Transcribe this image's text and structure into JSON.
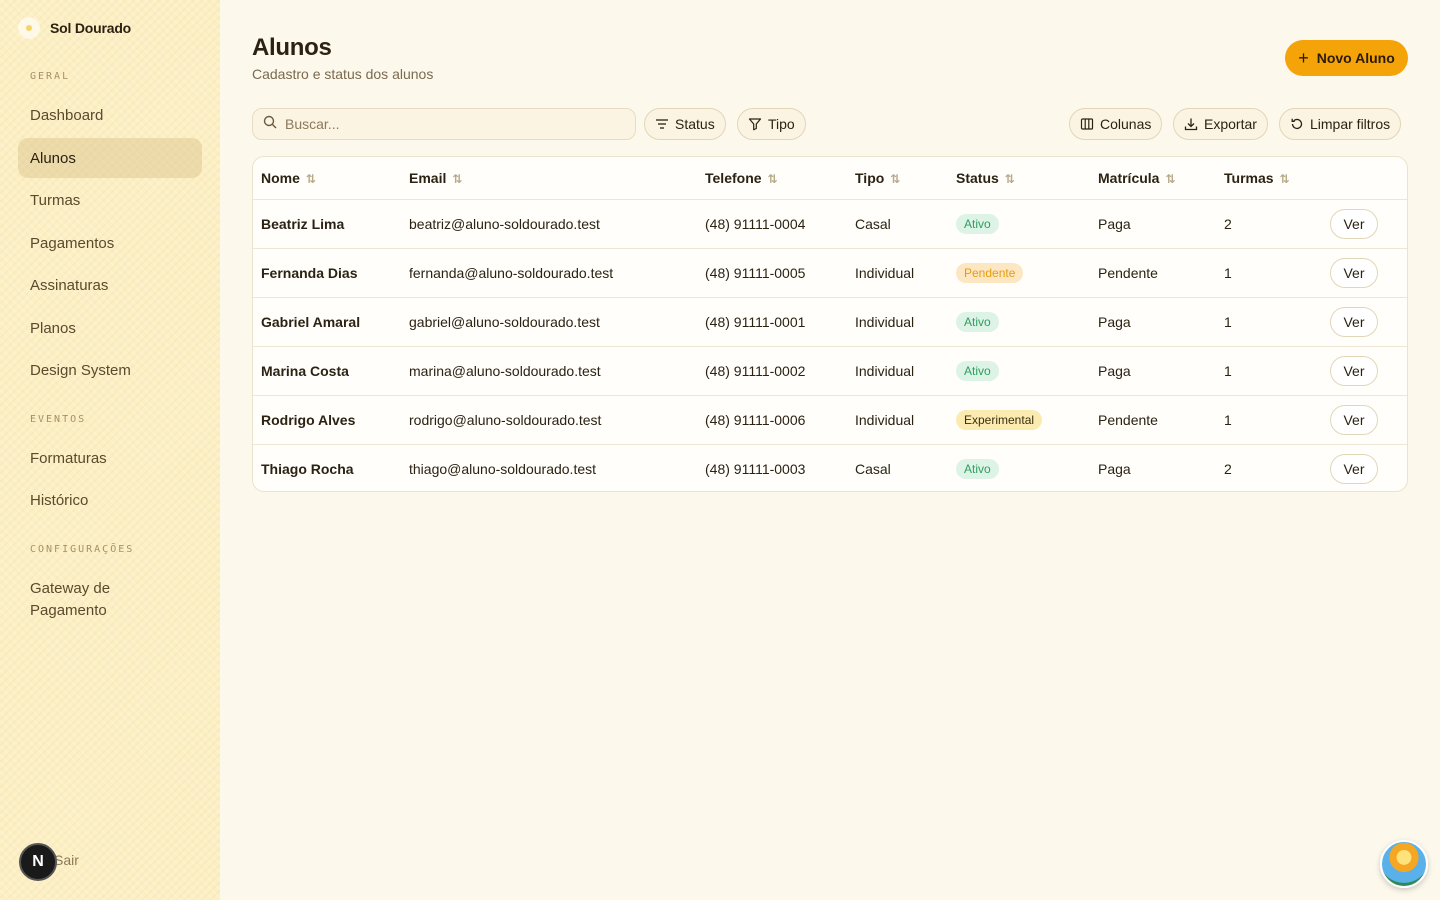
{
  "brand": {
    "name": "Sol Dourado"
  },
  "sidebar": {
    "sections": [
      {
        "label": "GERAL",
        "items": [
          "Dashboard",
          "Alunos",
          "Turmas",
          "Pagamentos",
          "Assinaturas",
          "Planos",
          "Design System"
        ]
      },
      {
        "label": "EVENTOS",
        "items": [
          "Formaturas",
          "Histórico"
        ]
      },
      {
        "label": "CONFIGURAÇÕES",
        "items": [
          "Gateway de Pagamento"
        ]
      }
    ],
    "active": "Alunos",
    "logout": "Sair"
  },
  "header": {
    "title": "Alunos",
    "subtitle": "Cadastro e status dos alunos",
    "new_button": "Novo Aluno"
  },
  "toolbar": {
    "search_placeholder": "Buscar...",
    "filter_status": "Status",
    "filter_tipo": "Tipo",
    "columns": "Colunas",
    "export": "Exportar",
    "clear_filters": "Limpar filtros"
  },
  "table": {
    "columns": [
      "Nome",
      "Email",
      "Telefone",
      "Tipo",
      "Status",
      "Matrícula",
      "Turmas"
    ],
    "action_label": "Ver",
    "rows": [
      {
        "nome": "Beatriz Lima",
        "email": "beatriz@aluno-soldourado.test",
        "telefone": "(48) 91111-0004",
        "tipo": "Casal",
        "status": "Ativo",
        "matricula": "Paga",
        "turmas": "2"
      },
      {
        "nome": "Fernanda Dias",
        "email": "fernanda@aluno-soldourado.test",
        "telefone": "(48) 91111-0005",
        "tipo": "Individual",
        "status": "Pendente",
        "matricula": "Pendente",
        "turmas": "1"
      },
      {
        "nome": "Gabriel Amaral",
        "email": "gabriel@aluno-soldourado.test",
        "telefone": "(48) 91111-0001",
        "tipo": "Individual",
        "status": "Ativo",
        "matricula": "Paga",
        "turmas": "1"
      },
      {
        "nome": "Marina Costa",
        "email": "marina@aluno-soldourado.test",
        "telefone": "(48) 91111-0002",
        "tipo": "Individual",
        "status": "Ativo",
        "matricula": "Paga",
        "turmas": "1"
      },
      {
        "nome": "Rodrigo Alves",
        "email": "rodrigo@aluno-soldourado.test",
        "telefone": "(48) 91111-0006",
        "tipo": "Individual",
        "status": "Experimental",
        "matricula": "Pendente",
        "turmas": "1"
      },
      {
        "nome": "Thiago Rocha",
        "email": "thiago@aluno-soldourado.test",
        "telefone": "(48) 91111-0003",
        "tipo": "Casal",
        "status": "Ativo",
        "matricula": "Paga",
        "turmas": "2"
      }
    ]
  },
  "colors": {
    "accent": "#F4A308",
    "sidebar_bg": "#FCEFC4",
    "status_ativo": "#2F9E62",
    "status_pendente": "#E39D12",
    "status_experimental_bg": "#FBEBB0"
  },
  "dev_badge": "N"
}
